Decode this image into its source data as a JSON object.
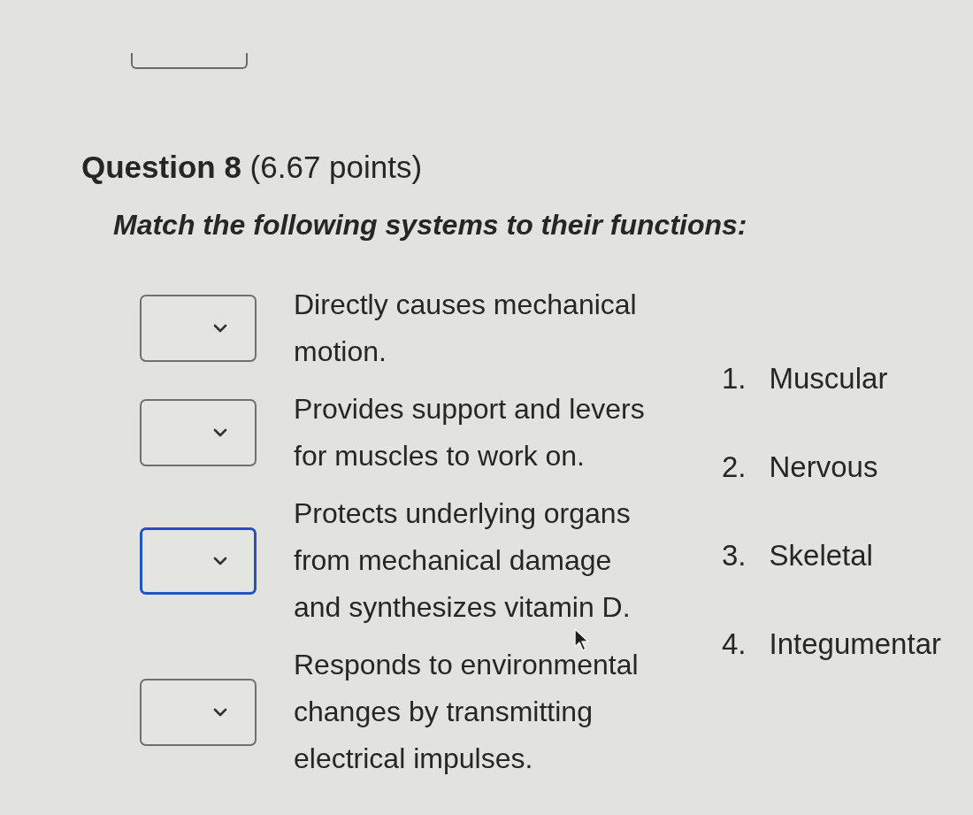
{
  "question": {
    "title": "**Question 8** (6.67 points)",
    "prompt": "Match the following systems to their functions:"
  },
  "matches": [
    {
      "text": "Directly causes mechanical motion.",
      "focused": false
    },
    {
      "text": "Provides support and levers for muscles to work on.",
      "focused": false
    },
    {
      "text": "Protects underlying organs from mechanical damage and synthesizes vitamin D.",
      "focused": true
    },
    {
      "text": "Responds to environmental changes by transmitting electrical impulses.",
      "focused": false
    }
  ],
  "options": [
    {
      "number": "1.",
      "label": "Muscular"
    },
    {
      "number": "2.",
      "label": "Nervous"
    },
    {
      "number": "3.",
      "label": "Skeletal"
    },
    {
      "number": "4.",
      "label": "Integumentar"
    }
  ]
}
